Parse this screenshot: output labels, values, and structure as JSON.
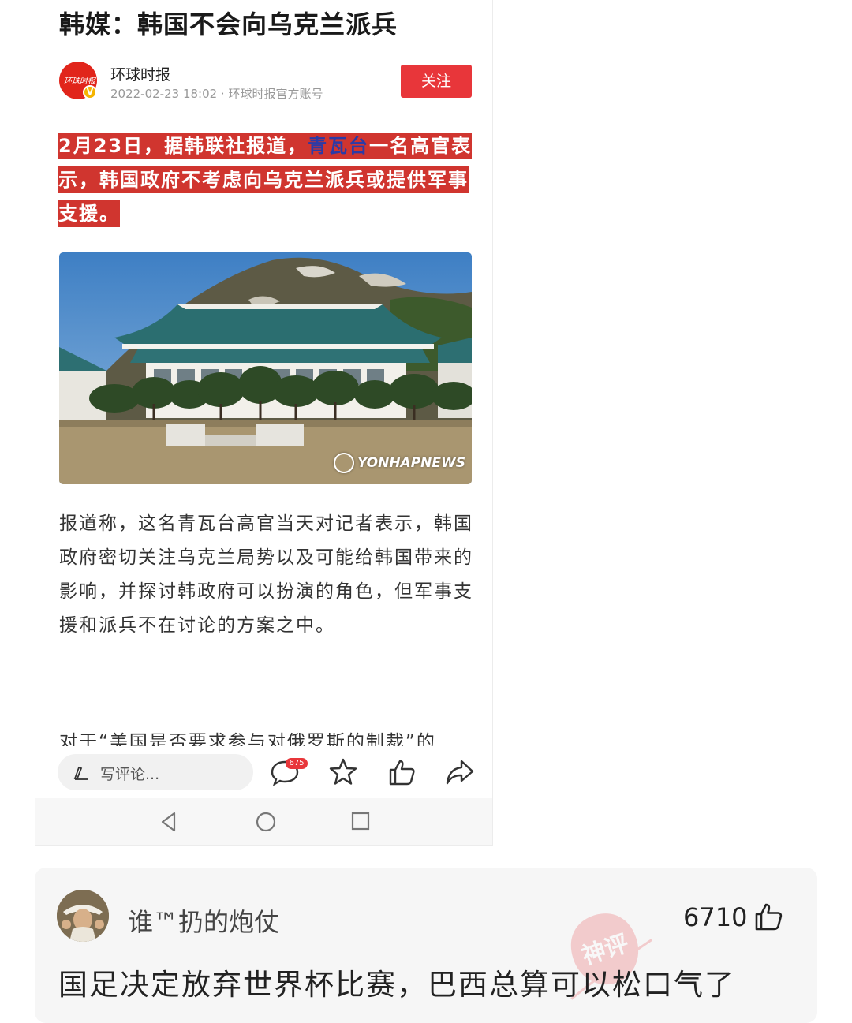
{
  "article": {
    "title": "韩媒：韩国不会向乌克兰派兵",
    "author": "环球时报",
    "avatar_logo_text": "环球时报",
    "meta": "2022-02-23 18:02 · 环球时报官方账号",
    "follow_label": "关注",
    "highlight": {
      "before": "2月23日，据韩联社报道，",
      "keyword": "青瓦台",
      "after": "一名高官表示，韩国政府不考虑向乌克兰派兵或提供军事支援。"
    },
    "photo_watermark": "YONHAPNEWS",
    "paragraph1": "报道称，这名青瓦台高官当天对记者表示，韩国政府密切关注乌克兰局势以及可能给韩国带来的影响，并探讨韩政府可以扮演的角色，但军事支援和派兵不在讨论的方案之中。",
    "paragraph2": "对于“美国是否要求参与对俄罗斯的制裁”的"
  },
  "actionbar": {
    "comment_placeholder": "写评论...",
    "comment_count": "675"
  },
  "top_comment": {
    "username": "谁™扔的炮仗",
    "likes": "6710",
    "stamp_text": "神评",
    "text": "国足决定放弃世界杯比赛，巴西总算可以松口气了"
  },
  "colors": {
    "accent_red": "#e8363a",
    "highlight_red": "#d0352f",
    "keyword_blue": "#2c3aa6"
  }
}
